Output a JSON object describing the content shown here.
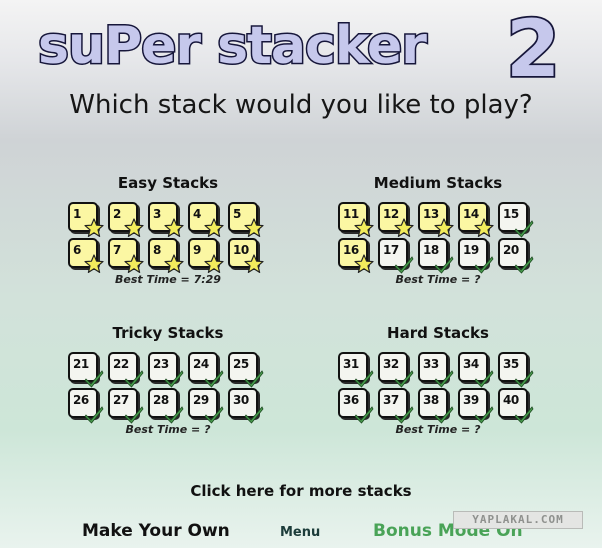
{
  "title": {
    "text": "suPer stacker",
    "number": "2"
  },
  "subtitle": "Which stack would you like to play?",
  "groups": [
    {
      "title": "Easy Stacks",
      "best_time": "Best Time = 7:29",
      "levels": [
        {
          "n": "1",
          "mark": "star"
        },
        {
          "n": "2",
          "mark": "star"
        },
        {
          "n": "3",
          "mark": "star"
        },
        {
          "n": "4",
          "mark": "star"
        },
        {
          "n": "5",
          "mark": "star"
        },
        {
          "n": "6",
          "mark": "star"
        },
        {
          "n": "7",
          "mark": "star"
        },
        {
          "n": "8",
          "mark": "star"
        },
        {
          "n": "9",
          "mark": "star"
        },
        {
          "n": "10",
          "mark": "star"
        }
      ]
    },
    {
      "title": "Medium Stacks",
      "best_time": "Best Time = ?",
      "levels": [
        {
          "n": "11",
          "mark": "star"
        },
        {
          "n": "12",
          "mark": "star"
        },
        {
          "n": "13",
          "mark": "star"
        },
        {
          "n": "14",
          "mark": "star"
        },
        {
          "n": "15",
          "mark": "check"
        },
        {
          "n": "16",
          "mark": "star"
        },
        {
          "n": "17",
          "mark": "check"
        },
        {
          "n": "18",
          "mark": "check"
        },
        {
          "n": "19",
          "mark": "check"
        },
        {
          "n": "20",
          "mark": "check"
        }
      ]
    },
    {
      "title": "Tricky Stacks",
      "best_time": "Best Time = ?",
      "levels": [
        {
          "n": "21",
          "mark": "check"
        },
        {
          "n": "22",
          "mark": "check"
        },
        {
          "n": "23",
          "mark": "check"
        },
        {
          "n": "24",
          "mark": "check"
        },
        {
          "n": "25",
          "mark": "check"
        },
        {
          "n": "26",
          "mark": "check"
        },
        {
          "n": "27",
          "mark": "check"
        },
        {
          "n": "28",
          "mark": "check"
        },
        {
          "n": "29",
          "mark": "check"
        },
        {
          "n": "30",
          "mark": "check"
        }
      ]
    },
    {
      "title": "Hard Stacks",
      "best_time": "Best Time = ?",
      "levels": [
        {
          "n": "31",
          "mark": "check"
        },
        {
          "n": "32",
          "mark": "check"
        },
        {
          "n": "33",
          "mark": "check"
        },
        {
          "n": "34",
          "mark": "check"
        },
        {
          "n": "35",
          "mark": "check"
        },
        {
          "n": "36",
          "mark": "check"
        },
        {
          "n": "37",
          "mark": "check"
        },
        {
          "n": "38",
          "mark": "check"
        },
        {
          "n": "39",
          "mark": "check"
        },
        {
          "n": "40",
          "mark": "check"
        }
      ]
    }
  ],
  "more_stacks": "Click here for more stacks",
  "footer": {
    "make_your_own": "Make Your Own",
    "menu": "Menu",
    "bonus_mode": "Bonus Mode On"
  },
  "watermark": "YAPLAKAL.COM",
  "colors": {
    "title_fill": "#c6c8ec",
    "title_outline": "#16163a",
    "star": "#f2ec5c",
    "check": "#4a9d4f",
    "completed_tile": "#fbf7a3"
  },
  "icons": {
    "star": "star-icon",
    "check": "check-icon"
  }
}
